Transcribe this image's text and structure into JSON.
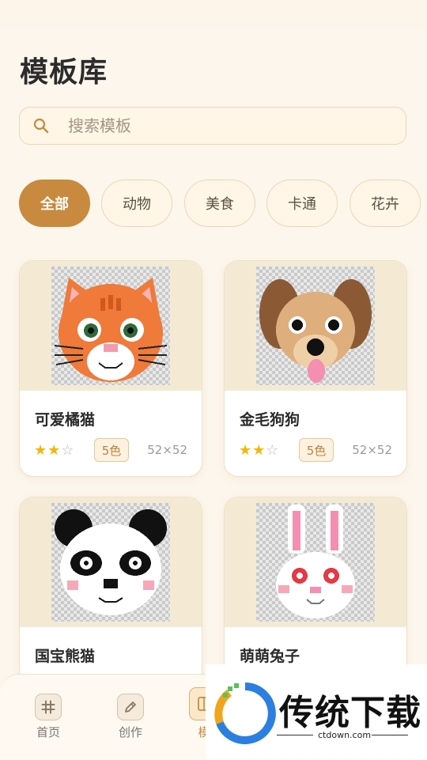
{
  "page": {
    "title": "模板库",
    "search": {
      "placeholder": "搜索模板"
    }
  },
  "categories": [
    {
      "label": "全部",
      "active": true
    },
    {
      "label": "动物",
      "active": false
    },
    {
      "label": "美食",
      "active": false
    },
    {
      "label": "卡通",
      "active": false
    },
    {
      "label": "花卉",
      "active": false
    }
  ],
  "templates": [
    {
      "name": "可爱橘猫",
      "rating": 2,
      "max_rating": 3,
      "colors": "5色",
      "size": "52×52",
      "image": "orange-cat"
    },
    {
      "name": "金毛狗狗",
      "rating": 2,
      "max_rating": 3,
      "colors": "5色",
      "size": "52×52",
      "image": "golden-dog"
    },
    {
      "name": "国宝熊猫",
      "image": "panda"
    },
    {
      "name": "萌萌兔子",
      "image": "bunny"
    }
  ],
  "tabbar": {
    "items": [
      {
        "label": "首页",
        "icon": "grid-hash-icon",
        "active": false
      },
      {
        "label": "创作",
        "icon": "edit-pencil-icon",
        "active": false
      },
      {
        "label": "模",
        "icon": "template-icon",
        "active": true
      }
    ]
  },
  "watermark": {
    "brand": "传统下载",
    "url": "ctdown.com"
  },
  "colors": {
    "accent": "#c88a3e",
    "background": "#fdf6ec",
    "chip_border": "#ead7b5",
    "star": "#f2b705"
  }
}
